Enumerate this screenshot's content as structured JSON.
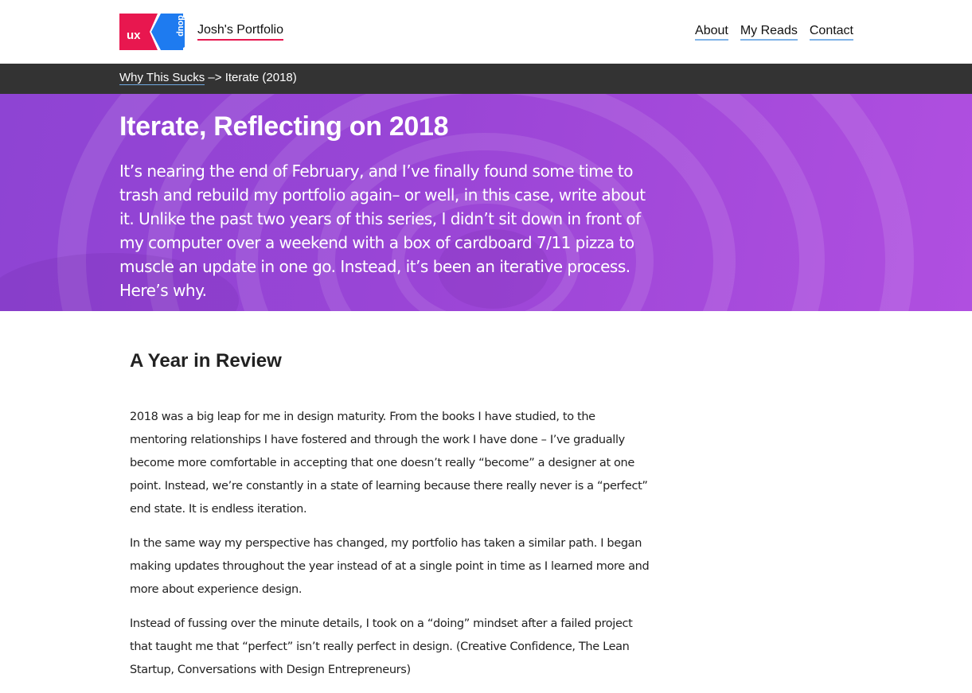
{
  "header": {
    "logo": {
      "text": "ux",
      "mark": "doup"
    },
    "site_title": "Josh's Portfolio",
    "nav": [
      {
        "label": "About"
      },
      {
        "label": "My Reads"
      },
      {
        "label": "Contact"
      }
    ]
  },
  "breadcrumb": {
    "parent": "Why This Sucks",
    "separator": "–>",
    "current": "Iterate (2018)"
  },
  "hero": {
    "title": "Iterate, Reflecting on 2018",
    "lead": "It’s nearing the end of February, and I’ve finally found some time to trash and rebuild my portfolio again– or well, in this case, write about it. Unlike the past two years of this series, I didn’t sit down in front of my computer over a weekend with a box of cardboard 7/11 pizza to muscle an update in one go. Instead, it’s been an iterative process. Here’s why."
  },
  "article": {
    "section_title": "A Year in Review",
    "paragraphs": [
      "2018 was a big leap for me in design maturity. From the books I have studied, to the mentoring relationships I have fostered and through the work I have done – I’ve gradually become more comfortable in accepting that one doesn’t really “become” a designer at one point. Instead, we’re constantly in a state of learning because there really never is a “perfect” end state. It is endless iteration.",
      "In the same way my perspective has changed, my portfolio has taken a similar path. I began making updates throughout the year instead of at a single point in time as I learned more and more about experience design.",
      "Instead of fussing over the minute details, I took on a “doing” mindset after a failed project that taught me that “perfect” isn’t really perfect in design. (Creative Confidence, The Lean Startup, Conversations with Design Entrepreneurs)"
    ]
  },
  "colors": {
    "accent_red": "#e8174f",
    "logo_blue": "#1e7bf0",
    "breadcrumb_bg": "#333333",
    "hero_purple": "#9a45d6",
    "link_underline": "#7fb3e8"
  }
}
